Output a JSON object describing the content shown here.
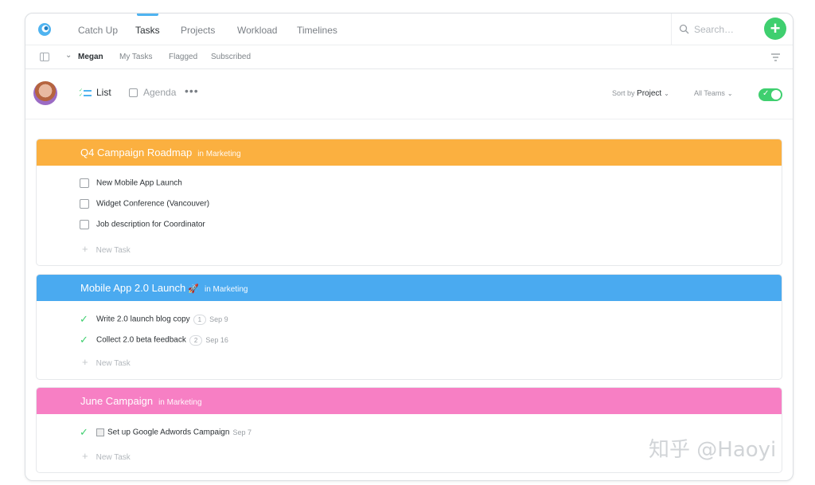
{
  "colors": {
    "accent_blue": "#4fb3f0",
    "green": "#3fcf6f",
    "orange_project": "#fbb040",
    "blue_project": "#4aaaf0",
    "pink_project": "#f77fc4"
  },
  "nav": {
    "logo_icon": "app-logo-icon",
    "tabs": [
      {
        "label": "Catch Up",
        "active": false
      },
      {
        "label": "Tasks",
        "active": true
      },
      {
        "label": "Projects",
        "active": false
      },
      {
        "label": "Workload",
        "active": false
      },
      {
        "label": "Timelines",
        "active": false
      }
    ],
    "search": {
      "placeholder": "Search…",
      "value": ""
    },
    "add_label": "+"
  },
  "subnav": {
    "user": "Megan",
    "items": [
      "My Tasks",
      "Flagged",
      "Subscribed"
    ]
  },
  "header": {
    "views": {
      "list": "List",
      "agenda": "Agenda",
      "more": "•••"
    },
    "sort": {
      "prefix": "Sort by",
      "value": "Project"
    },
    "teams": "All Teams",
    "toggle_on": true
  },
  "projects": [
    {
      "title": "Q4 Campaign Roadmap",
      "team": "in Marketing",
      "tasks": [
        {
          "label": "New Mobile App Launch",
          "done": false
        },
        {
          "label": "Widget Conference (Vancouver)",
          "done": false
        },
        {
          "label": "Job description for Coordinator",
          "done": false
        }
      ],
      "new_task": "New Task"
    },
    {
      "title": "Mobile App 2.0 Launch",
      "emoji": "🚀",
      "team": "in Marketing",
      "tasks": [
        {
          "label": "Write 2.0 launch blog copy",
          "done": true,
          "count": "1",
          "date": "Sep 9"
        },
        {
          "label": "Collect 2.0 beta feedback",
          "done": true,
          "count": "2",
          "date": "Sep 16"
        }
      ],
      "new_task": "New Task"
    },
    {
      "title": "June Campaign",
      "team": "in Marketing",
      "tasks": [
        {
          "label": "Set up Google Adwords Campaign",
          "done": true,
          "date": "Sep 7"
        }
      ],
      "new_task": "New Task"
    }
  ],
  "watermark": "知乎 @Haoyi"
}
